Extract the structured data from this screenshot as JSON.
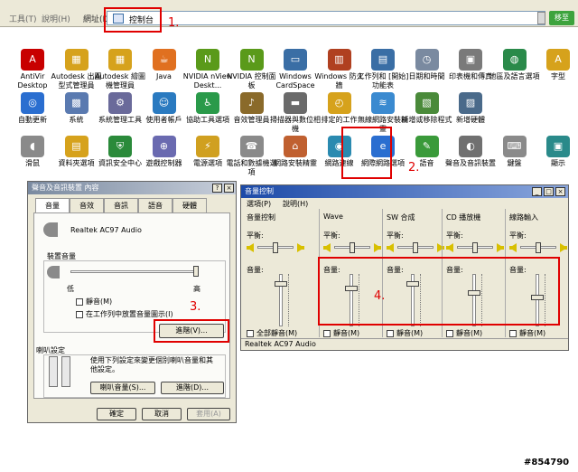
{
  "menubar": {
    "menus": [
      "工具(T)",
      "說明(H)"
    ],
    "address_label": "網址(D)",
    "address_value": "控制台",
    "go_label": "移至"
  },
  "steps": {
    "s1": "1.",
    "s2": "2.",
    "s3": "3.",
    "s4": "4."
  },
  "control_panel": {
    "items": [
      {
        "label": "AntiVir Desktop",
        "icon": "antivir-icon",
        "color": "#c80000",
        "glyph": "A"
      },
      {
        "label": "Autodesk 出圖型式管理員",
        "icon": "folder-icon",
        "color": "#d6a21c",
        "glyph": "▦"
      },
      {
        "label": "Autodesk 繪圖機管理員",
        "icon": "folder-icon",
        "color": "#d6a21c",
        "glyph": "▦"
      },
      {
        "label": "Java",
        "icon": "java-icon",
        "color": "#e07020",
        "glyph": "☕"
      },
      {
        "label": "NVIDIA nView Deskt...",
        "icon": "nvidia-icon",
        "color": "#5a9a1a",
        "glyph": "N"
      },
      {
        "label": "NVIDIA 控制面板",
        "icon": "nvidia-icon",
        "color": "#5a9a1a",
        "glyph": "N"
      },
      {
        "label": "Windows CardSpace",
        "icon": "cardspace-icon",
        "color": "#3a6ea5",
        "glyph": "▭"
      },
      {
        "label": "Windows 防火牆",
        "icon": "firewall-icon",
        "color": "#b04020",
        "glyph": "▥"
      },
      {
        "label": "工作列和 [開始] 功能表",
        "icon": "taskbar-icon",
        "color": "#3a6ea5",
        "glyph": "▤"
      },
      {
        "label": "日期和時間",
        "icon": "clock-icon",
        "color": "#7a8aa0",
        "glyph": "◷"
      },
      {
        "label": "印表機和傳真",
        "icon": "printer-icon",
        "color": "#7a7a7a",
        "glyph": "▣"
      },
      {
        "label": "地區及語言選項",
        "icon": "globe-icon",
        "color": "#2a8a4a",
        "glyph": "◍"
      },
      {
        "label": "字型",
        "icon": "fonts-folder-icon",
        "color": "#d6a21c",
        "glyph": "A"
      },
      {
        "label": "自動更新",
        "icon": "update-icon",
        "color": "#2a6ed0",
        "glyph": "◎"
      },
      {
        "label": "系統",
        "icon": "system-icon",
        "color": "#5a7ab0",
        "glyph": "▩"
      },
      {
        "label": "系統管理工具",
        "icon": "admin-tools-icon",
        "color": "#6a6a9a",
        "glyph": "⚙"
      },
      {
        "label": "使用者帳戶",
        "icon": "users-icon",
        "color": "#2a7ac0",
        "glyph": "☺"
      },
      {
        "label": "協助工具選項",
        "icon": "accessibility-icon",
        "color": "#2a9a4a",
        "glyph": "♿"
      },
      {
        "label": "音效管理員",
        "icon": "speaker-icon",
        "color": "#8a6a2a",
        "glyph": "♪"
      },
      {
        "label": "掃描器與數位相機",
        "icon": "scanner-icon",
        "color": "#6a6a6a",
        "glyph": "▬"
      },
      {
        "label": "排定的工作",
        "icon": "tasks-icon",
        "color": "#d6a21c",
        "glyph": "◴"
      },
      {
        "label": "無線網路安裝精靈",
        "icon": "wireless-icon",
        "color": "#3a8ad0",
        "glyph": "≋"
      },
      {
        "label": "新增或移除程式",
        "icon": "add-remove-icon",
        "color": "#4a8a3a",
        "glyph": "▧"
      },
      {
        "label": "新增硬體",
        "icon": "hardware-icon",
        "color": "#4a6a8a",
        "glyph": "▨"
      },
      {
        "label": "滑鼠",
        "icon": "mouse-icon",
        "color": "#8a8a8a",
        "glyph": "◖"
      },
      {
        "label": "資料夾選項",
        "icon": "folder-options-icon",
        "color": "#d6a21c",
        "glyph": "▤"
      },
      {
        "label": "資訊安全中心",
        "icon": "security-shield-icon",
        "color": "#2a8a3a",
        "glyph": "⛨"
      },
      {
        "label": "遊戲控制器",
        "icon": "gamepad-icon",
        "color": "#6a6ab0",
        "glyph": "⊕"
      },
      {
        "label": "電源選項",
        "icon": "power-icon",
        "color": "#d0a020",
        "glyph": "⚡"
      },
      {
        "label": "電話和數據機選項",
        "icon": "phone-icon",
        "color": "#8a8a8a",
        "glyph": "☎"
      },
      {
        "label": "網路安裝精靈",
        "icon": "home-network-icon",
        "color": "#c06030",
        "glyph": "⌂"
      },
      {
        "label": "網路連線",
        "icon": "network-icon",
        "color": "#2a8ab0",
        "glyph": "◉"
      },
      {
        "label": "網際網路選項",
        "icon": "internet-icon",
        "color": "#2a6ed0",
        "glyph": "e"
      },
      {
        "label": "語音",
        "icon": "speech-icon",
        "color": "#3a9a3a",
        "glyph": "✎"
      },
      {
        "label": "聲音及音訊裝置",
        "icon": "sound-devices-icon",
        "color": "#707070",
        "glyph": "◐"
      },
      {
        "label": "鍵盤",
        "icon": "keyboard-icon",
        "color": "#8a8a8a",
        "glyph": "⌨"
      },
      {
        "label": "顯示",
        "icon": "display-icon",
        "color": "#2a8a8a",
        "glyph": "▣"
      }
    ]
  },
  "sound_props": {
    "title": "聲音及音訊裝置 內容",
    "tabs": [
      "音量",
      "音效",
      "音訊",
      "語音",
      "硬體"
    ],
    "device_name": "Realtek AC97 Audio",
    "group_device_volume": "裝置音量",
    "low": "低",
    "high": "高",
    "mute_label": "靜音(M)",
    "tray_label": "在工作列中放置音量圖示(I)",
    "advanced_btn": "進階(V)...",
    "speaker_group": "喇叭設定",
    "speaker_desc": "使用下列設定來變更個別喇叭音量和其他設定。",
    "speaker_volume_btn": "喇叭音量(S)...",
    "speaker_advanced_btn": "進階(D)...",
    "ok_btn": "確定",
    "cancel_btn": "取消",
    "apply_btn": "套用(A)"
  },
  "mixer": {
    "title": "音量控制",
    "menus": [
      "選項(P)",
      "說明(H)"
    ],
    "channels": [
      {
        "name": "音量控制",
        "balance": "平衡:",
        "volume": "音量:",
        "mute": "全部靜音(M)",
        "level": 0.85
      },
      {
        "name": "Wave",
        "balance": "平衡:",
        "volume": "音量:",
        "mute": "靜音(M)",
        "level": 0.75
      },
      {
        "name": "SW 合成",
        "balance": "平衡:",
        "volume": "音量:",
        "mute": "靜音(M)",
        "level": 0.85
      },
      {
        "name": "CD 播放機",
        "balance": "平衡:",
        "volume": "音量:",
        "mute": "靜音(M)",
        "level": 0.65
      },
      {
        "name": "線路輸入",
        "balance": "平衡:",
        "volume": "音量:",
        "mute": "靜音(M)",
        "level": 0.55
      }
    ],
    "status": "Realtek AC97 Audio"
  },
  "watermark": "#854790"
}
